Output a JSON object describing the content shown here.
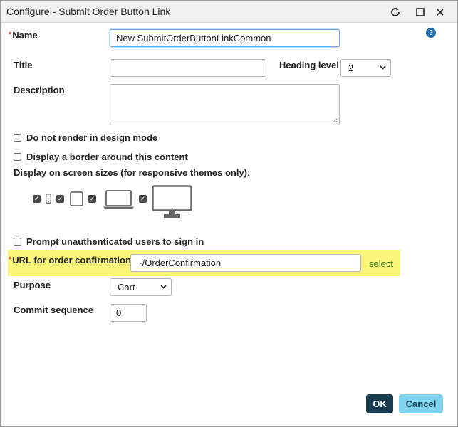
{
  "window": {
    "title": "Configure - Submit Order Button Link",
    "icons": [
      "refresh-icon",
      "maximize-icon",
      "close-icon"
    ]
  },
  "help": {
    "glyph": "?"
  },
  "form": {
    "name": {
      "required_mark": "*",
      "label": "Name",
      "value": "New SubmitOrderButtonLinkCommon"
    },
    "title": {
      "label": "Title",
      "value": ""
    },
    "heading_level": {
      "label": "Heading level",
      "value": "2"
    },
    "description": {
      "label": "Description",
      "value": ""
    },
    "do_not_render": {
      "label": "Do not render in design mode",
      "checked": false
    },
    "display_border": {
      "label": "Display a border around this content",
      "checked": false
    },
    "screen_sizes": {
      "label": "Display on screen sizes (for responsive themes only):",
      "devices": [
        {
          "name": "phone",
          "checked": true
        },
        {
          "name": "tablet",
          "checked": true
        },
        {
          "name": "laptop",
          "checked": true
        },
        {
          "name": "desktop",
          "checked": true
        }
      ]
    },
    "prompt_sign_in": {
      "label": "Prompt unauthenticated users to sign in",
      "checked": false
    },
    "url_confirmation": {
      "required_mark": "*",
      "label": "URL for order confirmation",
      "value": "~/OrderConfirmation",
      "select_label": "select"
    },
    "purpose": {
      "label": "Purpose",
      "value": "Cart"
    },
    "commit_sequence": {
      "label": "Commit sequence",
      "value": "0"
    }
  },
  "buttons": {
    "ok": "OK",
    "cancel": "Cancel"
  },
  "colors": {
    "highlight": "#fbf57a",
    "ok_bg": "#173b4f",
    "cancel_bg": "#7fd3ef",
    "link": "#2e7d1f",
    "help": "#1f6fae"
  }
}
